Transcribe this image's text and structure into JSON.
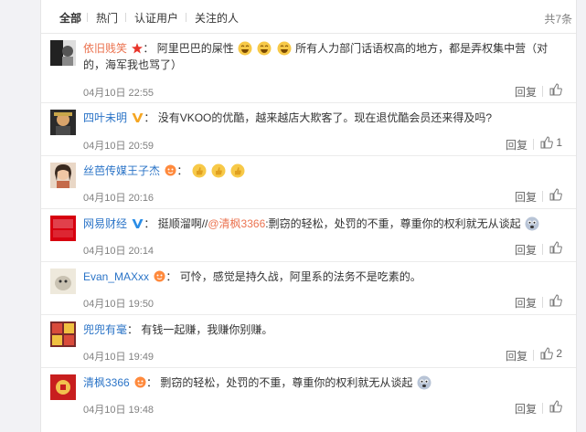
{
  "tabs": [
    {
      "label": "全部"
    },
    {
      "label": "热门"
    },
    {
      "label": "认证用户"
    },
    {
      "label": "关注的人"
    }
  ],
  "total_label": "共7条",
  "reply_label": "回复",
  "accent_color": "#eb7350",
  "comments": [
    {
      "user": "依旧贱笑",
      "badge": "red-star-icon",
      "text": "阿里巴巴的屎性",
      "emojis": [
        "laugh-emoji",
        "laugh-emoji",
        "laugh-emoji"
      ],
      "text2": "所有人力部门话语权高的地方，都是弄权集中营（对的，海军我也骂了）",
      "time": "04月10日 22:55",
      "likes": ""
    },
    {
      "user": "四叶未明",
      "badge": "yellow-v-icon",
      "text": "没有VKOO的优酷，越来越店大欺客了。现在退优酷会员还来得及吗?",
      "time": "04月10日 20:59",
      "likes": "1"
    },
    {
      "user": "丝芭传媒王子杰",
      "badge": "orange-face-icon",
      "text": "",
      "emojis": [
        "thumb-emoji",
        "thumb-emoji",
        "thumb-emoji"
      ],
      "time": "04月10日 20:16",
      "likes": ""
    },
    {
      "user": "网易财经",
      "badge": "blue-v-icon",
      "text": "挺顺溜啊//",
      "mention": "@清枫3366",
      "text2": ":剽窃的轻松，处罚的不重，尊重你的权利就无从谈起",
      "emojis": [
        "cry-emoji"
      ],
      "time": "04月10日 20:14",
      "likes": ""
    },
    {
      "user": "Evan_MAXxx",
      "badge": "orange-face-icon",
      "text": "可怜，感觉是持久战，阿里系的法务不是吃素的。",
      "time": "04月10日 19:50",
      "likes": ""
    },
    {
      "user": "兜兜有毫",
      "badge": "",
      "text": "有钱一起赚，我赚你别赚。",
      "time": "04月10日 19:49",
      "likes": "2"
    },
    {
      "user": "清枫3366",
      "badge": "orange-face-icon",
      "text": "剽窃的轻松，处罚的不重，尊重你的权利就无从谈起",
      "emojis": [
        "cry-emoji"
      ],
      "time": "04月10日 19:48",
      "likes": ""
    }
  ]
}
